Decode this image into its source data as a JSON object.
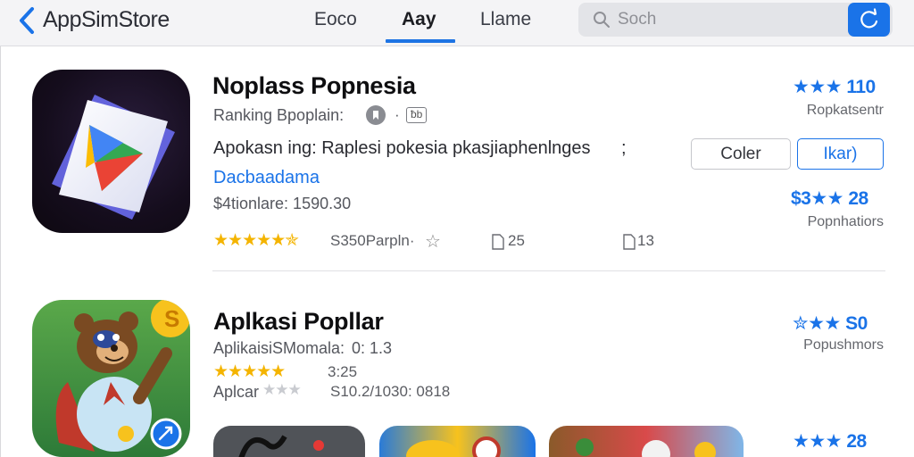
{
  "header": {
    "brand": "AppSimStore",
    "tabs": [
      {
        "label": "Eoco"
      },
      {
        "label": "Aay"
      },
      {
        "label": "Llame"
      }
    ],
    "search": {
      "placeholder": "Soch"
    }
  },
  "apps": [
    {
      "title": "Noplass Popnesia",
      "subtitle": "Ranking Bpoplain:",
      "badge_box": "ƀb",
      "description": "Apokasn ing: Raplesi pokesia pkasjiaphenlnges",
      "link": "Dacbaadama",
      "price": "$4tionlare: 1590.30",
      "rating_stars": 4.5,
      "meta_text": "S350Parpln·",
      "stat_a": "25",
      "stat_b": "13",
      "button_secondary": "Coler",
      "button_primary": "Ikar)",
      "right_rating_1": "110",
      "right_label_1": "Ropkatsentr",
      "right_rating_2": "28",
      "right_prefix_2": "$3",
      "right_label_2": "Popnhatiors"
    },
    {
      "title": "Aplkasi Popllar",
      "subtitle": "AplikaisiSMomala:",
      "subtitle_extra": "0: 1.3",
      "rating_stars": 5,
      "rating_text": "3:25",
      "third_line_prefix": "Aplcar",
      "third_line_stars": 3,
      "third_line_text": "S10.2/1030: 0818",
      "right_rating_1": "S0",
      "right_label_1": "Popushmors",
      "right_rating_2": "28"
    }
  ],
  "colors": {
    "accent": "#1a73e8",
    "star": "#f4b400",
    "topbar": "#f4f4f6"
  }
}
